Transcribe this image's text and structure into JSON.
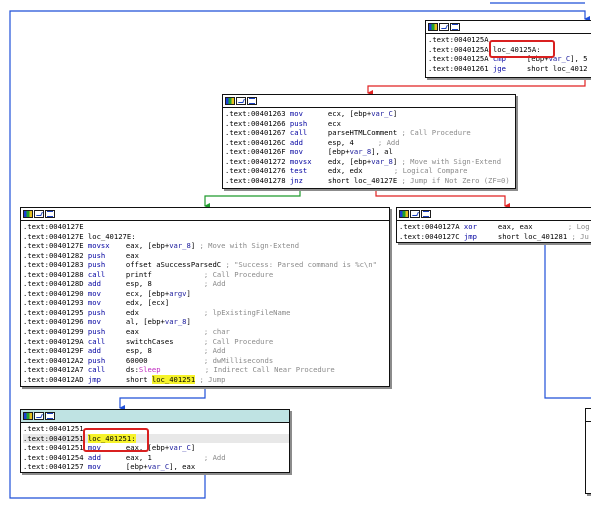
{
  "colors": {
    "edge_blue": "#1f4fd8",
    "edge_red": "#e02222",
    "edge_green": "#1e9a2c",
    "highlight_yellow": "#f6f32a",
    "selected_header": "#bfe3e3",
    "annotation_red": "#d92020"
  },
  "icons": [
    "color-palette-icon",
    "graph-overview-icon",
    "listing-icon"
  ],
  "nodes": {
    "top_right": {
      "lines": [
        {
          "addr": ".text:0040125A",
          "mn": "",
          "ops": "",
          "cmt": ""
        },
        {
          "addr": ".text:0040125A",
          "label": "loc_40125A:"
        },
        {
          "addr": ".text:0040125A",
          "mn": "cmp",
          "ops_a": "[ebp+",
          "ops_var": "var_C",
          "ops_b": "], 5"
        },
        {
          "addr": ".text:00401261",
          "mn": "jge",
          "ops": "short loc_4012"
        }
      ]
    },
    "middle": {
      "lines": [
        {
          "addr": ".text:00401263",
          "mn": "mov",
          "ops_a": "ecx, [ebp+",
          "ops_var": "var_C",
          "ops_b": "]",
          "cmt": ""
        },
        {
          "addr": ".text:00401266",
          "mn": "push",
          "ops": "ecx",
          "cmt": ""
        },
        {
          "addr": ".text:00401267",
          "mn": "call",
          "ops": "parseHTMLComment",
          "cmt": "; Call Procedure"
        },
        {
          "addr": ".text:0040126C",
          "mn": "add",
          "ops": "esp, 4",
          "cmt": "; Add"
        },
        {
          "addr": ".text:0040126F",
          "mn": "mov",
          "ops_a": "[ebp+",
          "ops_var": "var_8",
          "ops_b": "], al",
          "cmt": ""
        },
        {
          "addr": ".text:00401272",
          "mn": "movsx",
          "ops_a": "edx, [ebp+",
          "ops_var": "var_8",
          "ops_b": "]",
          "cmt": "; Move with Sign-Extend"
        },
        {
          "addr": ".text:00401276",
          "mn": "test",
          "ops": "edx, edx",
          "cmt": "; Logical Compare"
        },
        {
          "addr": ".text:00401278",
          "mn": "jnz",
          "ops": "short loc_40127E",
          "cmt": "; Jump if Not Zero (ZF=0)"
        }
      ]
    },
    "left": {
      "lines": [
        {
          "addr": ".text:0040127E",
          "mn": "",
          "ops": "",
          "cmt": ""
        },
        {
          "addr": ".text:0040127E",
          "label": "loc_40127E:"
        },
        {
          "addr": ".text:0040127E",
          "mn": "movsx",
          "ops_a": "eax, [ebp+",
          "ops_var": "var_8",
          "ops_b": "]",
          "cmt": "; Move with Sign-Extend"
        },
        {
          "addr": ".text:00401282",
          "mn": "push",
          "ops": "eax",
          "cmt": ""
        },
        {
          "addr": ".text:00401283",
          "mn": "push",
          "ops": "offset aSuccessParsedC",
          "cmt": "; \"Success: Parsed command is %c\\n\""
        },
        {
          "addr": ".text:00401288",
          "mn": "call",
          "ops": "printf",
          "cmt": "; Call Procedure"
        },
        {
          "addr": ".text:0040128D",
          "mn": "add",
          "ops": "esp, 8",
          "cmt": "; Add"
        },
        {
          "addr": ".text:00401290",
          "mn": "mov",
          "ops_a": "ecx, [ebp+",
          "ops_var": "argv",
          "ops_b": "]",
          "cmt": ""
        },
        {
          "addr": ".text:00401293",
          "mn": "mov",
          "ops": "edx, [ecx]",
          "cmt": ""
        },
        {
          "addr": ".text:00401295",
          "mn": "push",
          "ops": "edx",
          "cmt": "; lpExistingFileName"
        },
        {
          "addr": ".text:00401296",
          "mn": "mov",
          "ops_a": "al, [ebp+",
          "ops_var": "var_8",
          "ops_b": "]",
          "cmt": ""
        },
        {
          "addr": ".text:00401299",
          "mn": "push",
          "ops": "eax",
          "cmt": "; char"
        },
        {
          "addr": ".text:0040129A",
          "mn": "call",
          "ops": "switchCases",
          "cmt": "; Call Procedure"
        },
        {
          "addr": ".text:0040129F",
          "mn": "add",
          "ops": "esp, 8",
          "cmt": "; Add"
        },
        {
          "addr": ".text:004012A2",
          "mn": "push",
          "ops": "60000",
          "cmt": "; dwMilliseconds"
        },
        {
          "addr": ".text:004012A7",
          "mn": "call",
          "ops_a": "ds:",
          "ops_pink": "Sleep",
          "cmt": "; Indirect Call Near Procedure"
        },
        {
          "addr": ".text:004012AD",
          "mn": "jmp",
          "ops_a": "short ",
          "ops_hl": "loc_401251",
          "cmt": "; Jump"
        }
      ]
    },
    "right_small": {
      "lines": [
        {
          "addr": ".text:0040127A",
          "mn": "xor",
          "ops": "eax, eax",
          "cmt": "; Log"
        },
        {
          "addr": ".text:0040127C",
          "mn": "jmp",
          "ops": "short loc_401281",
          "cmt": "; Ju"
        }
      ]
    },
    "bottom": {
      "lines": [
        {
          "addr": ".text:00401251",
          "mn": "",
          "ops": "",
          "cmt": ""
        },
        {
          "addr": ".text:00401251",
          "label_hl": "loc_401251:"
        },
        {
          "addr": ".text:00401251",
          "mn": "mov",
          "ops_a": "eax, [ebp+",
          "ops_var": "var_C",
          "ops_b": "]",
          "cmt": ""
        },
        {
          "addr": ".text:00401254",
          "mn": "add",
          "ops": "eax, 1",
          "cmt": "; Add"
        },
        {
          "addr": ".text:00401257",
          "mn": "mov",
          "ops_a": "[ebp+",
          "ops_var": "var_C",
          "ops_b": "], eax",
          "cmt": ""
        }
      ]
    }
  }
}
